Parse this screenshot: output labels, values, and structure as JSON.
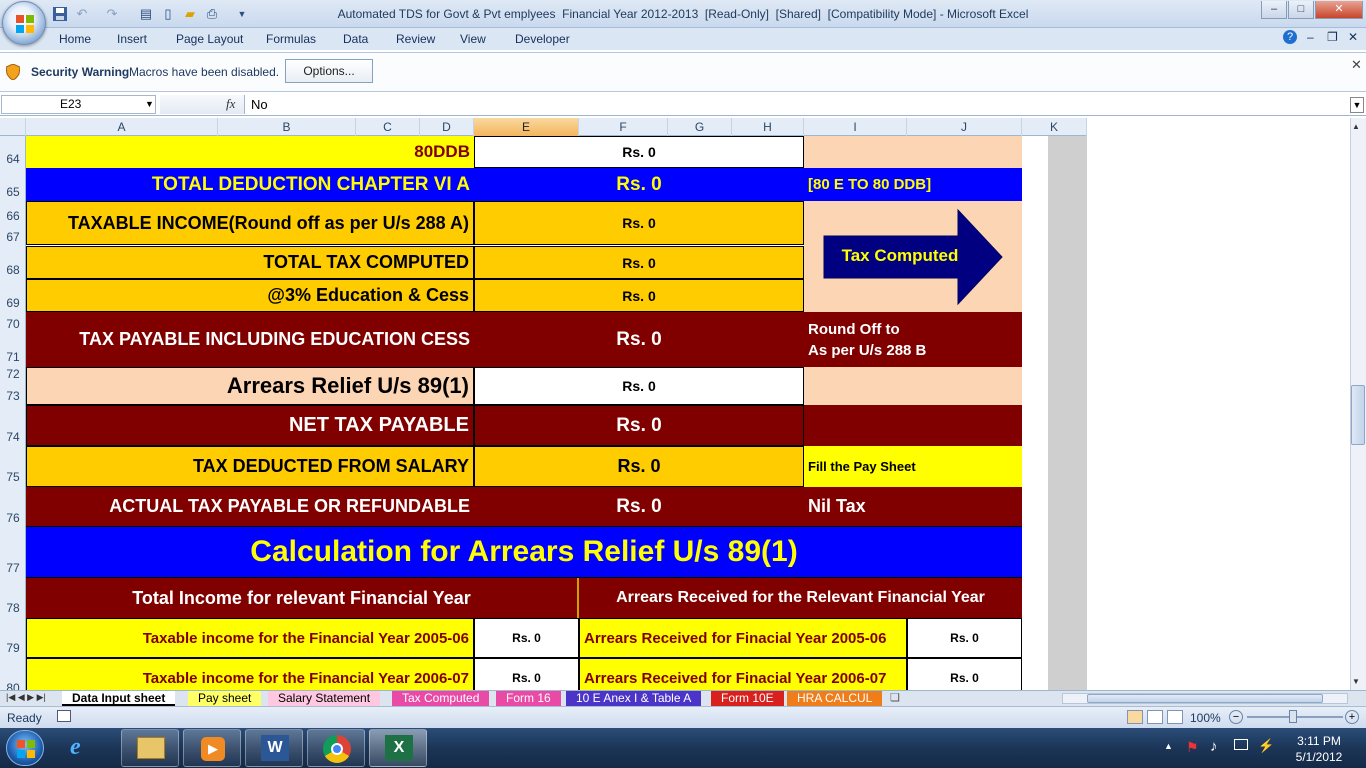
{
  "window": {
    "title": "Automated TDS for Govt & Pvt emplyees  Financial Year 2012-2013  [Read-Only]  [Shared]  [Compatibility Mode] - Microsoft Excel",
    "min_glyph": "–",
    "max_glyph": "□",
    "close_glyph": "✕"
  },
  "ribbon": {
    "tabs": [
      "Home",
      "Insert",
      "Page Layout",
      "Formulas",
      "Data",
      "Review",
      "View",
      "Developer"
    ]
  },
  "security": {
    "title": "Security Warning",
    "message": "Macros have been disabled.",
    "options_label": "Options..."
  },
  "formula_bar": {
    "cell_ref": "E23",
    "fx": "fx",
    "value": "No"
  },
  "columns": [
    "A",
    "B",
    "C",
    "D",
    "E",
    "F",
    "G",
    "H",
    "I",
    "J",
    "K"
  ],
  "rows": [
    {
      "num": "64",
      "label": "80DDB",
      "value": "Rs. 0",
      "note": ""
    },
    {
      "num": "65",
      "label": "TOTAL DEDUCTION CHAPTER VI A",
      "value": "Rs. 0",
      "note": "[80 E TO  80 DDB]"
    },
    {
      "num": "66",
      "label": "TAXABLE INCOME(Round off as per U/s 288 A)",
      "value": "Rs. 0"
    },
    {
      "num": "67"
    },
    {
      "num": "68",
      "label": "TOTAL TAX COMPUTED",
      "value": "Rs. 0"
    },
    {
      "num": "69",
      "label": "@3% Education & Cess",
      "value": "Rs. 0"
    },
    {
      "num": "70",
      "label": "TAX PAYABLE INCLUDING EDUCATION CESS",
      "value": "Rs. 0",
      "note_line1": "Round Off to",
      "note_line2": "As per U/s 288 B"
    },
    {
      "num": "71"
    },
    {
      "num": "72",
      "label": "Arrears Relief U/s 89(1)",
      "value": "Rs. 0"
    },
    {
      "num": "73"
    },
    {
      "num": "74",
      "label": "NET TAX PAYABLE",
      "value": "Rs. 0"
    },
    {
      "num": "75",
      "label": "TAX DEDUCTED FROM SALARY",
      "value": "Rs. 0",
      "note": "Fill the Pay Sheet"
    },
    {
      "num": "76",
      "label": "ACTUAL TAX PAYABLE OR REFUNDABLE",
      "value": "Rs. 0",
      "note": "Nil Tax"
    },
    {
      "num": "77",
      "label": "Calculation for Arrears Relief U/s 89(1)"
    },
    {
      "num": "78",
      "left_header": "Total Income for relevant Financial Year",
      "right_header": "Arrears Received for the Relevant Financial Year"
    },
    {
      "num": "79",
      "label": "Taxable income for the Financial Year 2005-06",
      "value": "Rs. 0",
      "arrears_label": "Arrears Received for Finacial Year 2005-06",
      "arrears_value": "Rs. 0"
    },
    {
      "num": "80",
      "label": "Taxable income for the Financial Year 2006-07",
      "value": "Rs. 0",
      "arrears_label": "Arrears Received for Finacial Year 2006-07",
      "arrears_value": "Rs. 0"
    }
  ],
  "tax_computed_label": "Tax Computed",
  "sheet_tabs": [
    "Data Input sheet",
    "Pay sheet",
    "Salary Statement",
    "Tax Computed",
    "Form 16",
    "10 E Anex I & Table A",
    "Form 10E",
    "HRA CALCUL"
  ],
  "status": {
    "ready": "Ready",
    "zoom": "100%"
  },
  "taskbar": {
    "time": "3:11 PM",
    "date": "5/1/2012"
  },
  "colors": {
    "yellow": "#ffff00",
    "blue": "#0000ff",
    "gold": "#ffcc00",
    "maroon": "#800000",
    "peach": "#fcd5b4",
    "navy": "#000080"
  }
}
